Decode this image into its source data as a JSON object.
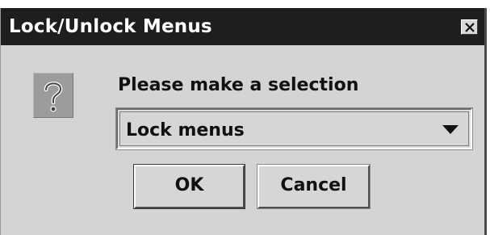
{
  "dialog": {
    "title": "Lock/Unlock Menus",
    "close_icon": "close-x-icon",
    "icon": "question-icon",
    "prompt": "Please make a selection",
    "select": {
      "selected_value": "Lock menus",
      "arrow_icon": "chevron-down-icon"
    },
    "buttons": {
      "ok_label": "OK",
      "cancel_label": "Cancel"
    }
  },
  "colors": {
    "titlebar": "#1e1e1e",
    "title_text": "#ffffff",
    "dialog_background": "#d4d4d4",
    "icon_background": "#9c9c9c"
  }
}
